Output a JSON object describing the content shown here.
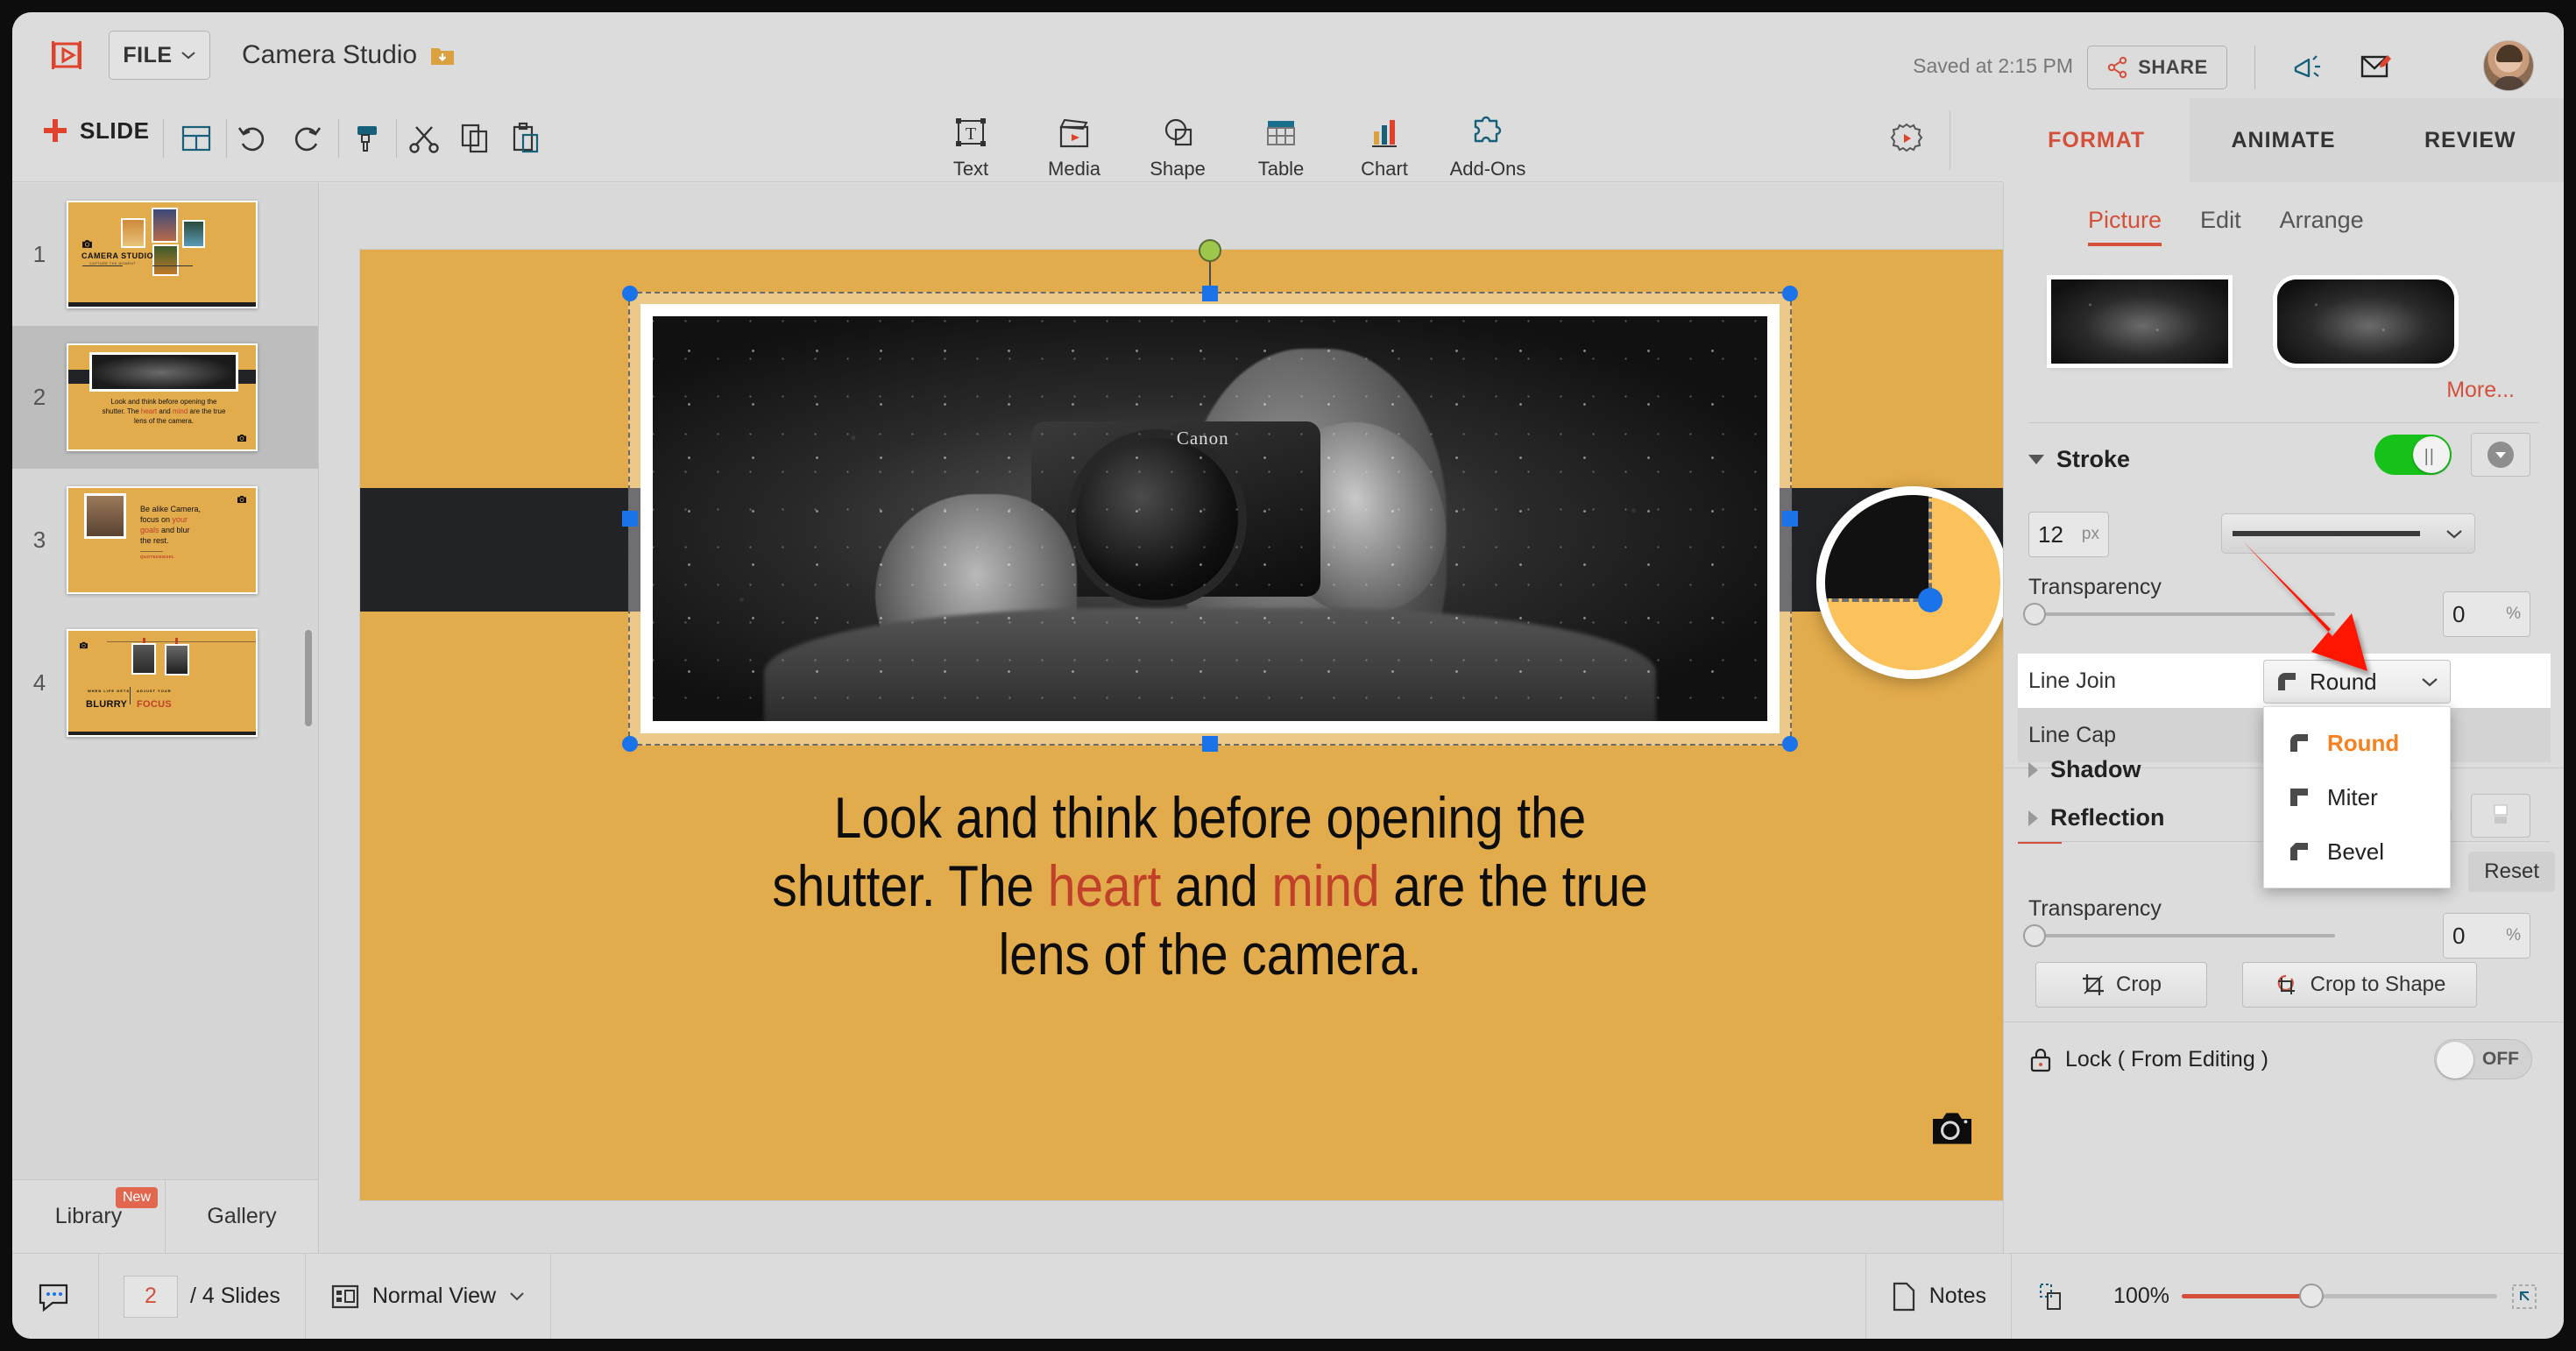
{
  "app": {
    "file_menu": "FILE",
    "document_title": "Camera Studio",
    "saved_status": "Saved at 2:15 PM",
    "share_label": "SHARE"
  },
  "toolbar": {
    "add_slide": "SLIDE",
    "tools": [
      {
        "label": "Text",
        "icon": "text-icon"
      },
      {
        "label": "Media",
        "icon": "media-icon"
      },
      {
        "label": "Shape",
        "icon": "shape-icon"
      },
      {
        "label": "Table",
        "icon": "table-icon"
      },
      {
        "label": "Chart",
        "icon": "chart-icon"
      },
      {
        "label": "Add-Ons",
        "icon": "addons-icon"
      }
    ],
    "play_label": "PLAY"
  },
  "right_panel": {
    "tabs": [
      {
        "label": "FORMAT",
        "active": true
      },
      {
        "label": "ANIMATE",
        "active": false
      },
      {
        "label": "REVIEW",
        "active": false
      }
    ],
    "sub_tabs": [
      {
        "label": "Picture",
        "active": true
      },
      {
        "label": "Edit",
        "active": false
      },
      {
        "label": "Arrange",
        "active": false
      }
    ],
    "more_label": "More...",
    "stroke": {
      "title": "Stroke",
      "enabled": true,
      "width_value": "12",
      "width_unit": "px",
      "transparency_label": "Transparency",
      "transparency_value": "0",
      "transparency_unit": "%"
    },
    "line_join": {
      "label": "Line Join",
      "selected": "Round",
      "options": [
        "Round",
        "Miter",
        "Bevel"
      ]
    },
    "line_cap": {
      "label": "Line Cap"
    },
    "shadow": {
      "title": "Shadow"
    },
    "reflection": {
      "title": "Reflection",
      "reset_label": "Reset",
      "transparency_label": "Transparency",
      "transparency_value": "0",
      "transparency_unit": "%"
    },
    "crop": {
      "crop_label": "Crop",
      "crop_to_shape_label": "Crop to Shape"
    },
    "lock": {
      "label": "Lock ( From Editing )",
      "state": "OFF"
    }
  },
  "sidebar": {
    "slides": [
      {
        "number": "1",
        "title": "CAMERA STUDIO",
        "subtitle": "CAPTURE THE MOMENT",
        "selected": false
      },
      {
        "number": "2",
        "body": "Look and think before opening the shutter. The heart and mind are the true lens of the camera.",
        "selected": true
      },
      {
        "number": "3",
        "body": "Be alike Camera, focus on your goals and blur the rest.",
        "caption": "QUOTEDEMSEL",
        "selected": false
      },
      {
        "number": "4",
        "pre1": "WHEN LIFE GETS",
        "pre2": "ADJUST YOUR",
        "big1": "BLURRY",
        "big2": "FOCUS",
        "selected": false
      }
    ],
    "library_label": "Library",
    "library_badge": "New",
    "gallery_label": "Gallery"
  },
  "slide": {
    "quote_line1": "Look and think before opening the",
    "quote_line2_a": "shutter. The ",
    "quote_highlight1": "heart",
    "quote_line2_b": " and ",
    "quote_highlight2": "mind",
    "quote_line2_c": " are the true",
    "quote_line3": "lens of the camera.",
    "background_color": "#e2ab4b",
    "band_color": "#222326",
    "highlight_color": "#c0402a"
  },
  "status_bar": {
    "current_slide": "2",
    "slide_count": "/ 4 Slides",
    "view_mode": "Normal View",
    "notes_label": "Notes",
    "zoom_level": "100%"
  }
}
